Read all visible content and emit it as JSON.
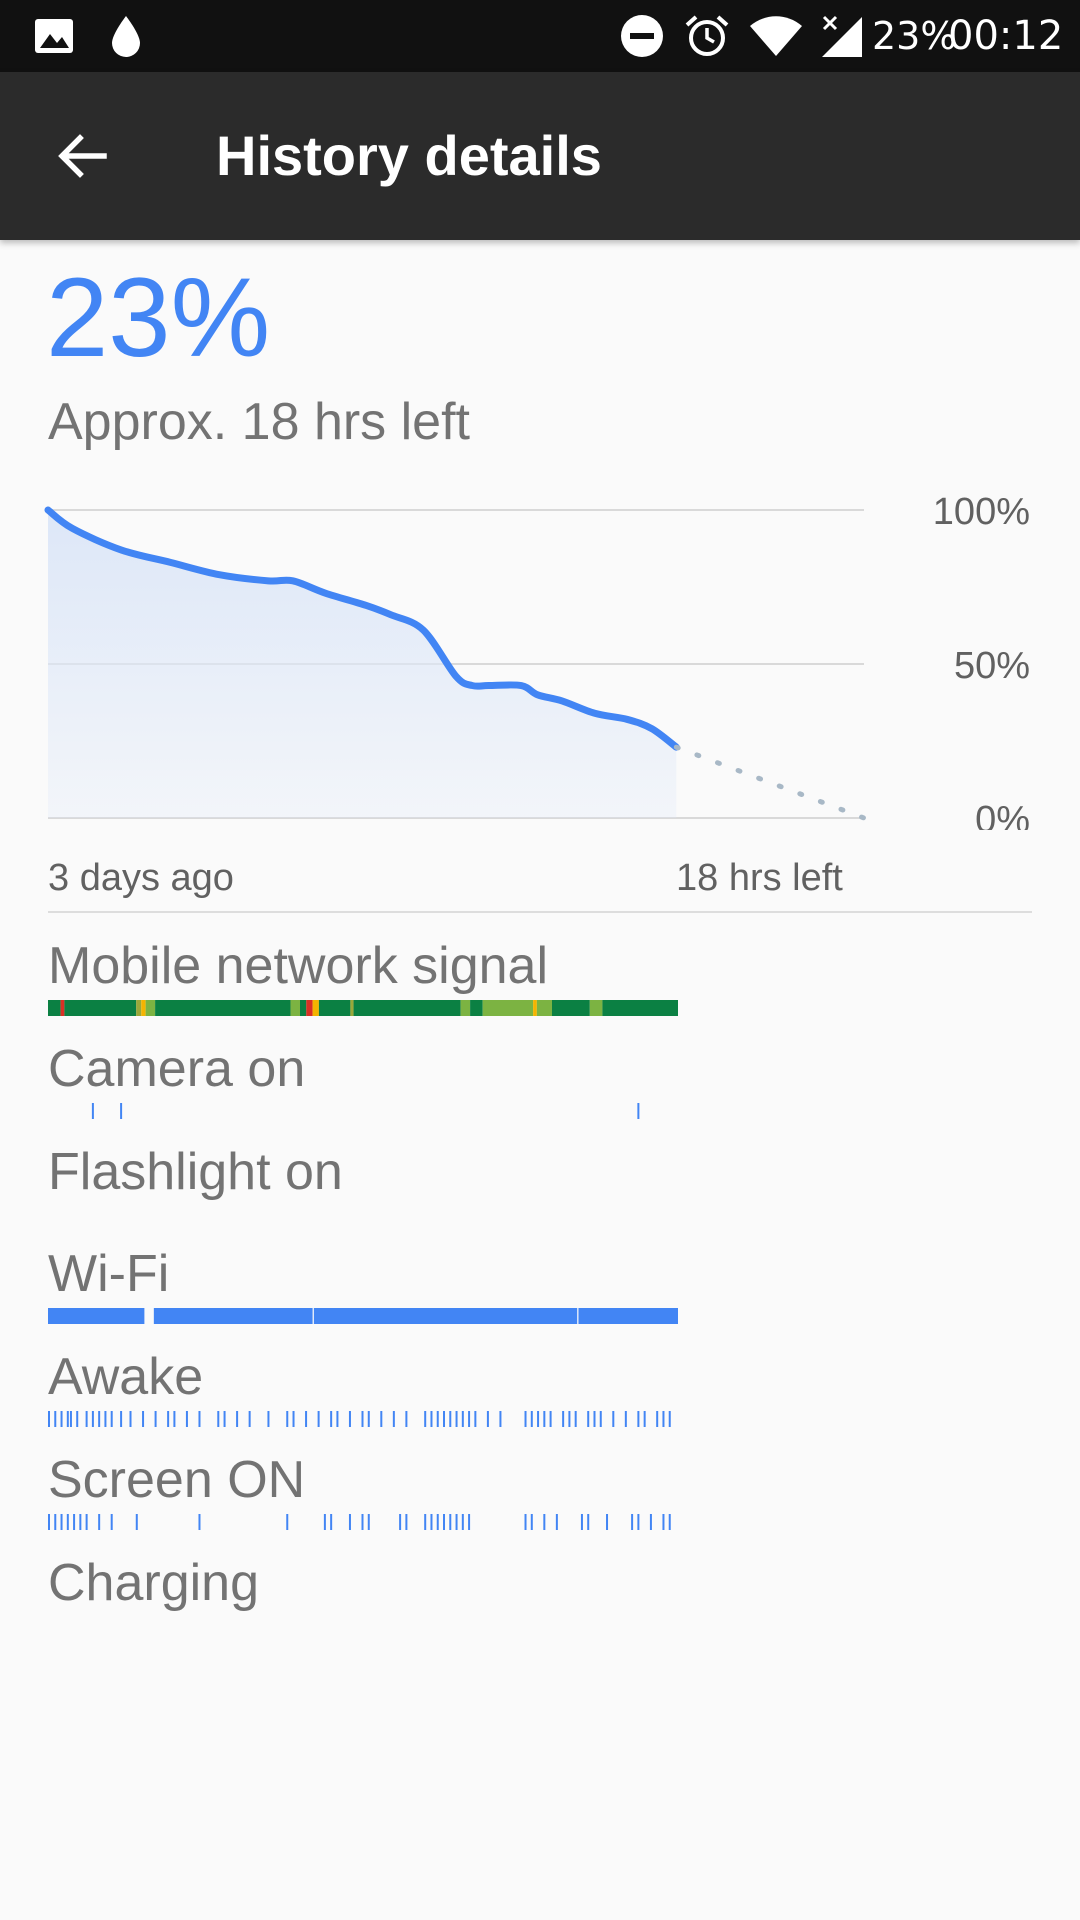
{
  "status_bar": {
    "left_icons": [
      "image-icon",
      "water-drop-icon"
    ],
    "right_icons": [
      "do-not-disturb-icon",
      "alarm-icon",
      "wifi-icon",
      "signal-no-data-icon"
    ],
    "battery_text": "23%",
    "time": "00:12"
  },
  "app_bar": {
    "back_icon": "arrow-back-icon",
    "title": "History details"
  },
  "battery": {
    "percent": "23%",
    "time_left": "Approx. 18 hrs left"
  },
  "chart_data": {
    "type": "area",
    "title": "",
    "ylim": [
      0,
      100
    ],
    "y_ticks": [
      "100%",
      "50%",
      "0%"
    ],
    "x_labels": [
      "3 days ago",
      "18 hrs left"
    ],
    "x_range_fraction": [
      0,
      1
    ],
    "series": [
      {
        "x": [
          0,
          0.03,
          0.09,
          0.15,
          0.21,
          0.27,
          0.3,
          0.34,
          0.39,
          0.42,
          0.46,
          0.5,
          0.52,
          0.54,
          0.58,
          0.6,
          0.63,
          0.67,
          0.71,
          0.74,
          0.77
        ],
        "values": [
          100,
          94,
          87,
          83,
          79,
          77,
          77,
          73,
          69,
          66,
          61,
          46,
          43,
          43,
          43,
          40,
          38,
          34,
          32,
          29,
          23
        ]
      }
    ],
    "projection": {
      "x": [
        0.77,
        1.0
      ],
      "values": [
        23,
        0
      ]
    },
    "colors": {
      "line": "#4285f4",
      "fill": "#dde7f8",
      "grid": "#d9d9d9",
      "projection": "#a8b8c6"
    },
    "grid": true
  },
  "history": {
    "rows": [
      {
        "label": "Mobile network signal",
        "kind": "signal"
      },
      {
        "label": "Camera on",
        "kind": "ticks",
        "events": [
          0.07,
          0.115,
          0.94
        ]
      },
      {
        "label": "Flashlight on",
        "kind": "none"
      },
      {
        "label": "Wi-Fi",
        "kind": "segments",
        "segments": [
          [
            0.0,
            0.153
          ],
          [
            0.168,
            0.42
          ],
          [
            0.422,
            0.84
          ],
          [
            0.842,
            1.0
          ]
        ]
      },
      {
        "label": "Awake",
        "kind": "ticks",
        "events": [
          0.0,
          0.01,
          0.02,
          0.03,
          0.035,
          0.045,
          0.06,
          0.07,
          0.08,
          0.09,
          0.1,
          0.115,
          0.13,
          0.15,
          0.17,
          0.19,
          0.2,
          0.22,
          0.24,
          0.27,
          0.28,
          0.3,
          0.32,
          0.35,
          0.38,
          0.39,
          0.41,
          0.43,
          0.45,
          0.46,
          0.48,
          0.5,
          0.51,
          0.53,
          0.55,
          0.57,
          0.6,
          0.61,
          0.62,
          0.63,
          0.64,
          0.65,
          0.66,
          0.67,
          0.68,
          0.7,
          0.72,
          0.76,
          0.77,
          0.78,
          0.79,
          0.8,
          0.82,
          0.83,
          0.84,
          0.86,
          0.87,
          0.88,
          0.9,
          0.92,
          0.94,
          0.95,
          0.97,
          0.98,
          0.99
        ]
      },
      {
        "label": "Screen ON",
        "kind": "ticks",
        "events": [
          0.0,
          0.01,
          0.02,
          0.03,
          0.04,
          0.05,
          0.06,
          0.08,
          0.1,
          0.14,
          0.24,
          0.38,
          0.44,
          0.45,
          0.48,
          0.5,
          0.51,
          0.56,
          0.57,
          0.6,
          0.61,
          0.62,
          0.63,
          0.64,
          0.65,
          0.66,
          0.67,
          0.76,
          0.77,
          0.79,
          0.81,
          0.85,
          0.86,
          0.89,
          0.93,
          0.94,
          0.96,
          0.98,
          0.99
        ]
      },
      {
        "label": "Charging",
        "kind": "none"
      }
    ],
    "signal_segments": [
      {
        "from": 0.0,
        "to": 0.02,
        "color": "#0b8043"
      },
      {
        "from": 0.02,
        "to": 0.026,
        "color": "#d93025"
      },
      {
        "from": 0.026,
        "to": 0.14,
        "color": "#0b8043"
      },
      {
        "from": 0.14,
        "to": 0.148,
        "color": "#9aa83a"
      },
      {
        "from": 0.148,
        "to": 0.155,
        "color": "#f4b400"
      },
      {
        "from": 0.155,
        "to": 0.17,
        "color": "#7cb342"
      },
      {
        "from": 0.17,
        "to": 0.385,
        "color": "#0b8043"
      },
      {
        "from": 0.385,
        "to": 0.4,
        "color": "#7cb342"
      },
      {
        "from": 0.4,
        "to": 0.41,
        "color": "#0b8043"
      },
      {
        "from": 0.41,
        "to": 0.42,
        "color": "#d93025"
      },
      {
        "from": 0.42,
        "to": 0.43,
        "color": "#f4b400"
      },
      {
        "from": 0.43,
        "to": 0.48,
        "color": "#0b8043"
      },
      {
        "from": 0.48,
        "to": 0.485,
        "color": "#9aa83a"
      },
      {
        "from": 0.485,
        "to": 0.655,
        "color": "#0b8043"
      },
      {
        "from": 0.655,
        "to": 0.67,
        "color": "#7cb342"
      },
      {
        "from": 0.67,
        "to": 0.69,
        "color": "#0b8043"
      },
      {
        "from": 0.69,
        "to": 0.77,
        "color": "#7cb342"
      },
      {
        "from": 0.77,
        "to": 0.776,
        "color": "#f4b400"
      },
      {
        "from": 0.776,
        "to": 0.8,
        "color": "#7cb342"
      },
      {
        "from": 0.8,
        "to": 0.86,
        "color": "#0b8043"
      },
      {
        "from": 0.86,
        "to": 0.88,
        "color": "#7cb342"
      },
      {
        "from": 0.88,
        "to": 1.0,
        "color": "#0b8043"
      }
    ],
    "colors": {
      "accent": "#4285f4"
    }
  }
}
